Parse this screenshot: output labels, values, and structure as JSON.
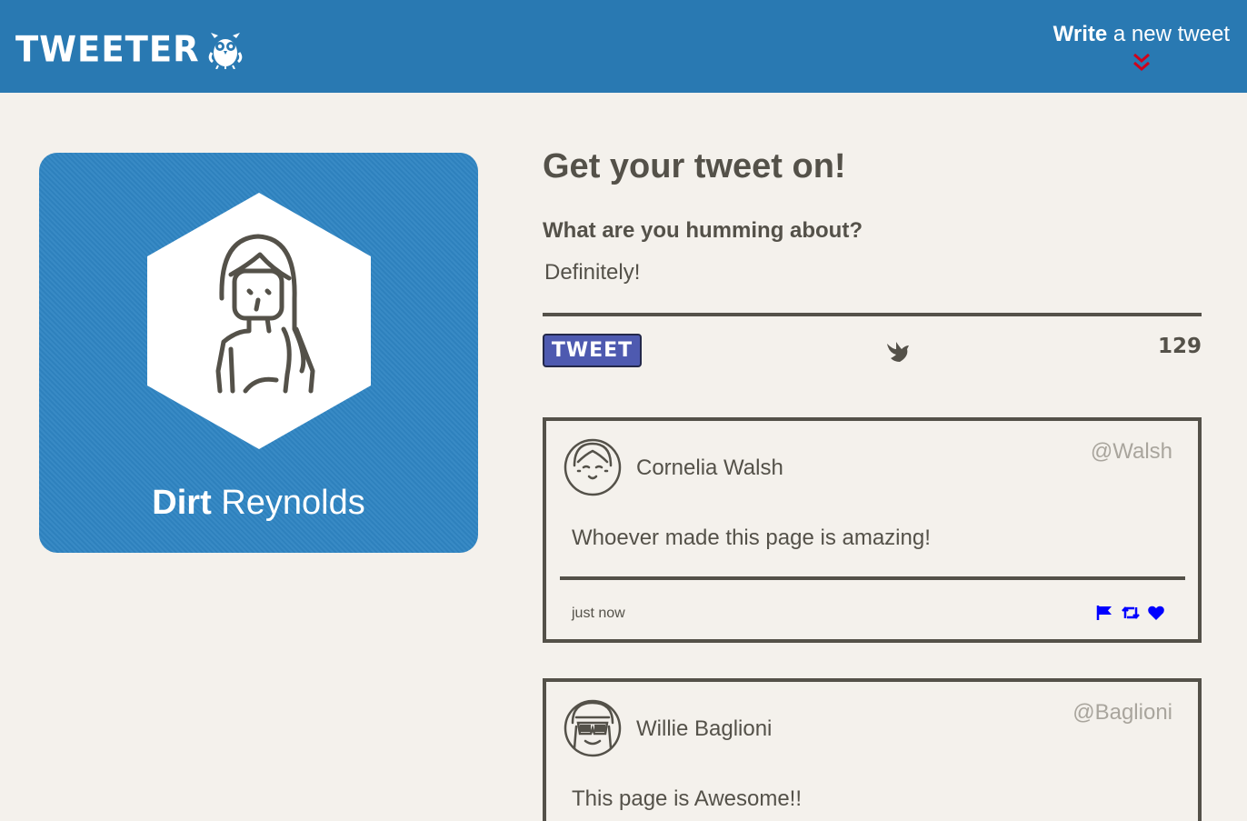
{
  "nav": {
    "brand": "TWEETER",
    "compose_bold": "Write",
    "compose_rest": " a new tweet"
  },
  "profile": {
    "first_name": "Dirt",
    "last_name": " Reynolds"
  },
  "composer": {
    "heading": "Get your tweet on!",
    "label": "What are you humming about?",
    "value": "Definitely!",
    "button": "TWEET",
    "counter": "129"
  },
  "tweets": [
    {
      "name": "Cornelia Walsh",
      "handle": "@Walsh",
      "text": "Whoever made this page is amazing!",
      "time": "just now"
    },
    {
      "name": "Willie Baglioni",
      "handle": "@Baglioni",
      "text": "This page is Awesome!!"
    }
  ],
  "colors": {
    "nav": "#2979b2",
    "background": "#f4f1ec",
    "text": "#545149",
    "button": "#4e5ab0",
    "action_icons": "#0000ff",
    "chevron": "#d0021b"
  },
  "icons": {
    "brand": "owl-icon",
    "compose": "double-chevron-down-icon",
    "composer": "bird-icon",
    "tweet_actions": [
      "flag-icon",
      "retweet-icon",
      "heart-icon"
    ]
  }
}
